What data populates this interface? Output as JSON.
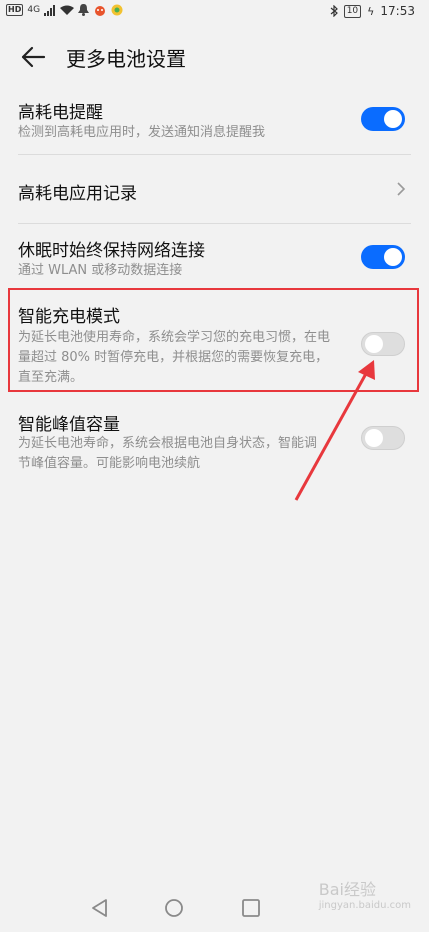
{
  "status": {
    "left_badges": [
      "HD",
      "4G"
    ],
    "battery": "10",
    "time": "17:53"
  },
  "header": {
    "title": "更多电池设置"
  },
  "settings": [
    {
      "title": "高耗电提醒",
      "subtitle": "检测到高耗电应用时，发送通知消息提醒我",
      "control": "toggle",
      "state": "on"
    },
    {
      "title": "高耗电应用记录",
      "control": "chevron"
    },
    {
      "title": "休眠时始终保持网络连接",
      "subtitle": "通过 WLAN 或移动数据连接",
      "control": "toggle",
      "state": "on"
    },
    {
      "title": "智能充电模式",
      "subtitle": "为延长电池使用寿命，系统会学习您的充电习惯，在电量超过 80% 时暂停充电，并根据您的需要恢复充电，直至充满。",
      "control": "toggle",
      "state": "off"
    },
    {
      "title": "智能峰值容量",
      "subtitle": "为延长电池寿命，系统会根据电池自身状态，智能调节峰值容量。可能影响电池续航",
      "control": "toggle",
      "state": "off"
    }
  ],
  "watermark": {
    "brand": "Bai经验",
    "url": "jingyan.baidu.com"
  },
  "colors": {
    "toggle_on": "#0a6cff",
    "toggle_off": "#dedede",
    "highlight": "#e8383d",
    "arrow": "#e8383d"
  }
}
